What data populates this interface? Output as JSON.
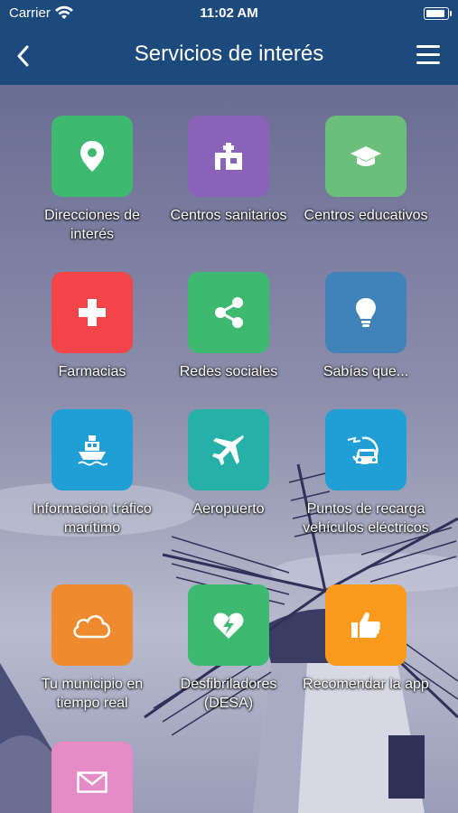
{
  "status": {
    "carrier": "Carrier",
    "time": "11:02 AM"
  },
  "nav": {
    "title": "Servicios de interés"
  },
  "icons": {
    "back": "chevron-left-icon",
    "menu": "hamburger-menu-icon"
  },
  "tiles": [
    {
      "label": "Direcciones de interés",
      "icon": "map-pin-icon",
      "color": "#3dba6f"
    },
    {
      "label": "Centros sanitarios",
      "icon": "hospital-icon",
      "color": "#8a63b8"
    },
    {
      "label": "Centros educativos",
      "icon": "graduation-cap-icon",
      "color": "#6bbf7a"
    },
    {
      "label": "Farmacias",
      "icon": "pharmacy-cross-icon",
      "color": "#f24449"
    },
    {
      "label": "Redes sociales",
      "icon": "share-icon",
      "color": "#3dba6f"
    },
    {
      "label": "Sabías que...",
      "icon": "lightbulb-icon",
      "color": "#3f83b8"
    },
    {
      "label": "Información tráfico marítimo",
      "icon": "ship-icon",
      "color": "#1f9fd6"
    },
    {
      "label": "Aeropuerto",
      "icon": "airplane-icon",
      "color": "#26b1a8"
    },
    {
      "label": "Puntos de recarga vehículos eléctricos",
      "icon": "ev-charging-icon",
      "color": "#1f9fd6"
    },
    {
      "label": "Tu municipio en tiempo real",
      "icon": "cloud-icon",
      "color": "#ef8a2e"
    },
    {
      "label": "Desfibriladores (DESA)",
      "icon": "defibrillator-heart-icon",
      "color": "#3dba6f"
    },
    {
      "label": "Recomendar la app",
      "icon": "thumbs-up-icon",
      "color": "#f99a1c"
    },
    {
      "label": "",
      "icon": "envelope-icon",
      "color": "#e58cc6"
    }
  ]
}
